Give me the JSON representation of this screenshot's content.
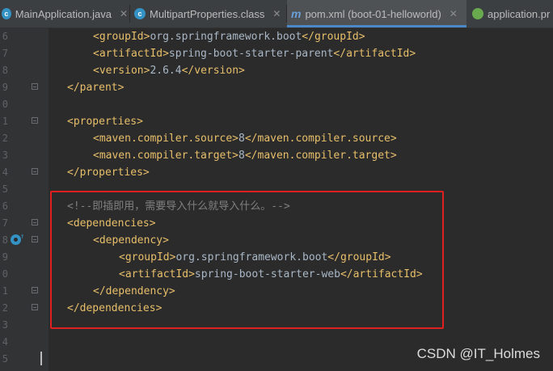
{
  "tabs": [
    {
      "label": "MainApplication.java",
      "icon": "java-class-icon",
      "color": "#3592c4",
      "closable": true,
      "active": false
    },
    {
      "label": "MultipartProperties.class",
      "icon": "class-file-icon",
      "color": "#3592c4",
      "closable": true,
      "active": false
    },
    {
      "label": "pom.xml (boot-01-helloworld)",
      "icon": "maven-m-icon",
      "color": "#4a88c7",
      "closable": true,
      "active": true
    },
    {
      "label": "application.pr",
      "icon": "spring-leaf-icon",
      "color": "#6aaa4f",
      "closable": false,
      "active": false
    }
  ],
  "line_numbers": [
    "6",
    "7",
    "8",
    "9",
    "0",
    "1",
    "2",
    "3",
    "4",
    "5",
    "6",
    "7",
    "8",
    "9",
    "0",
    "1",
    "2",
    "3",
    "4",
    "5"
  ],
  "code": {
    "l1": {
      "open": "<groupId>",
      "text": "org.springframework.boot",
      "close": "</groupId>"
    },
    "l2": {
      "open": "<artifactId>",
      "text": "spring-boot-starter-parent",
      "close": "</artifactId>"
    },
    "l3": {
      "open": "<version>",
      "text": "2.6.4",
      "close": "</version>"
    },
    "l4": {
      "tag": "</parent>"
    },
    "l6": {
      "tag": "<properties>"
    },
    "l7": {
      "open": "<maven.compiler.source>",
      "text": "8",
      "close": "</maven.compiler.source>"
    },
    "l8": {
      "open": "<maven.compiler.target>",
      "text": "8",
      "close": "</maven.compiler.target>"
    },
    "l9": {
      "tag": "</properties>"
    },
    "l11": {
      "comment": "<!--即插即用，需要导入什么就导入什么。-->"
    },
    "l12": {
      "tag": "<dependencies>"
    },
    "l13": {
      "tag": "<dependency>"
    },
    "l14": {
      "open": "<groupId>",
      "text": "org.springframework.boot",
      "close": "</groupId>"
    },
    "l15": {
      "open": "<artifactId>",
      "text": "spring-boot-starter-web",
      "close": "</artifactId>"
    },
    "l16": {
      "tag": "</dependency>"
    },
    "l17": {
      "tag": "</dependencies>"
    }
  },
  "watermark": "CSDN @IT_Holmes",
  "colors": {
    "tag": "#e8bf6a",
    "text": "#a9b7c6",
    "comment": "#808080",
    "highlight": "#e02020"
  }
}
